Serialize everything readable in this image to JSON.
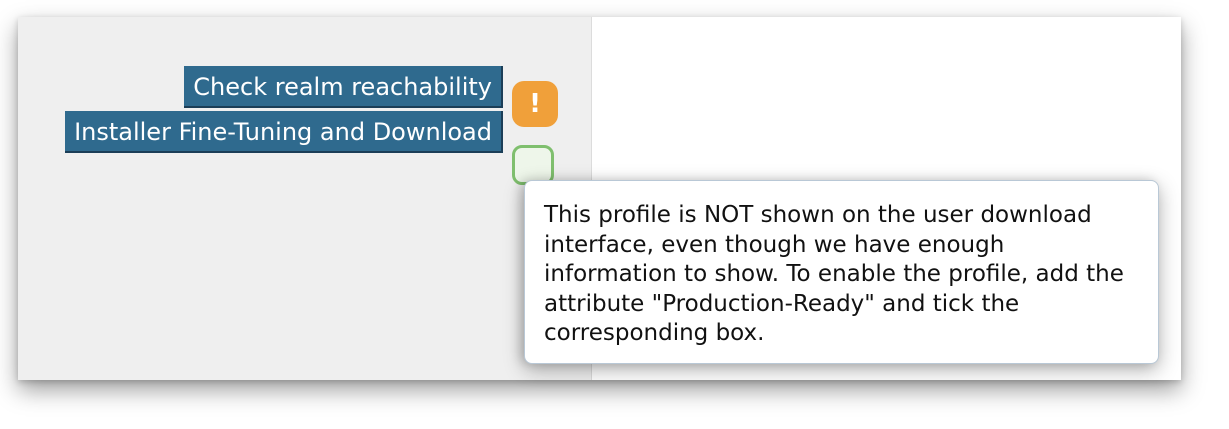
{
  "buttons": {
    "check_realm": "Check realm reachability",
    "installer": "Installer Fine-Tuning and Download"
  },
  "status_icons": {
    "warning": {
      "icon": "exclamation-icon",
      "glyph": "!",
      "color": "#f0a03a"
    },
    "ok": {
      "icon": "check-box-icon",
      "color": "#7fbf6e"
    }
  },
  "tooltip": {
    "text": "This profile is NOT shown on the user download interface, even though we have enough information to show. To enable the profile, add the attribute \"Production-Ready\" and tick the corresponding box."
  },
  "colors": {
    "button_bg": "#2f6a8e",
    "panel_bg": "#efefef"
  }
}
